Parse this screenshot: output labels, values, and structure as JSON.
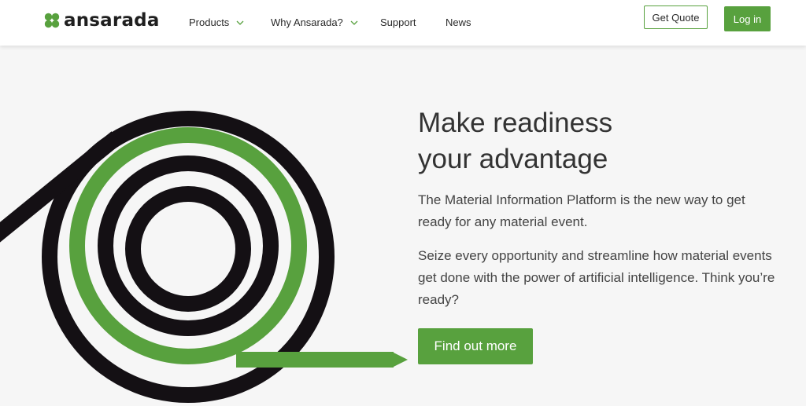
{
  "header": {
    "logo_text": "ansarada",
    "nav": [
      {
        "label": "Products",
        "has_dropdown": true,
        "icon": "chevron-down-icon"
      },
      {
        "label": "Why Ansarada?",
        "has_dropdown": true,
        "icon": "chevron-down-icon"
      },
      {
        "label": "Support",
        "has_dropdown": false
      },
      {
        "label": "News",
        "has_dropdown": false
      }
    ],
    "get_quote_label": "Get Quote",
    "login_label": "Log in"
  },
  "hero": {
    "title_line1": "Make readiness",
    "title_line2": "your advantage",
    "paragraph1": "The Material Information Platform is the new way to get ready for any material event.",
    "paragraph2": "Seize every opportunity and streamline how material events get done with the power of artificial intelligence. Think you’re ready?",
    "cta_label": "Find out more"
  },
  "colors": {
    "brand_green": "#58a13e",
    "spiral_black": "#141014",
    "page_background": "#f6f6f6",
    "header_background": "#ffffff"
  }
}
